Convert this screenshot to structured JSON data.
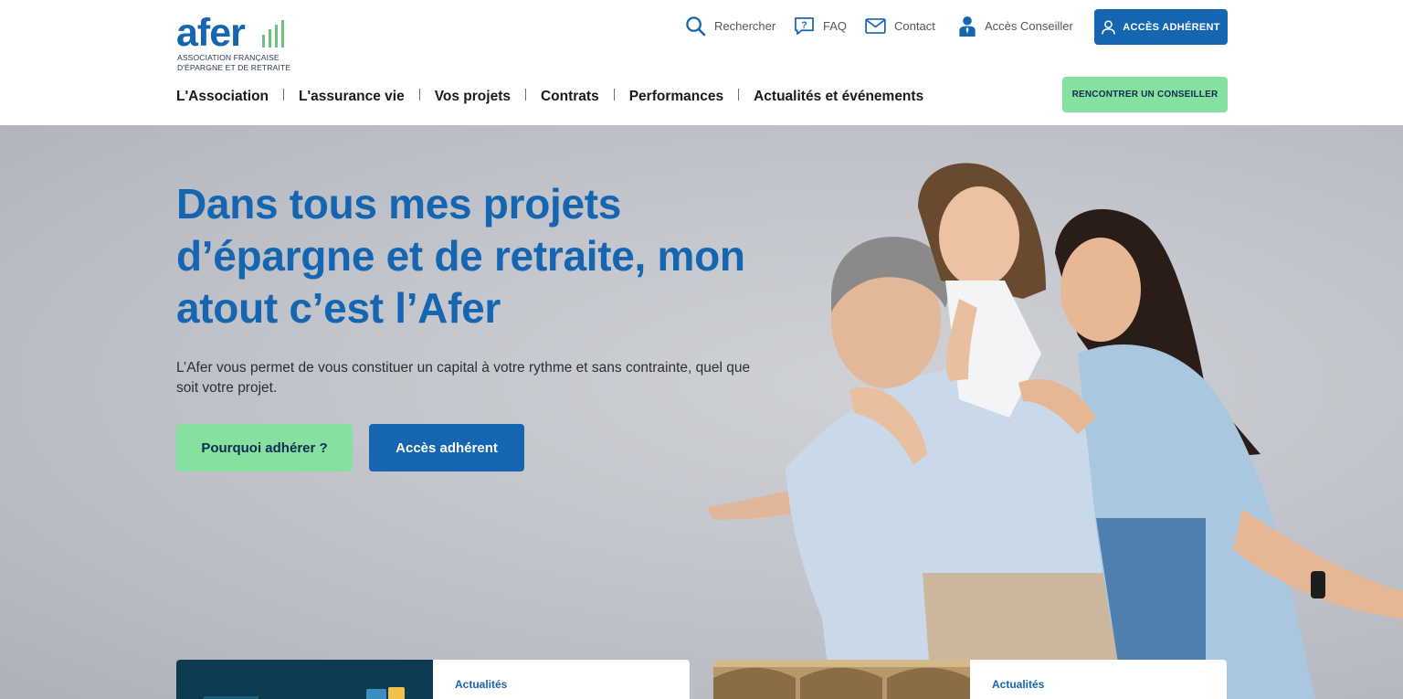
{
  "logo": {
    "word": "afer",
    "subtitle_line1": "ASSOCIATION FRANÇAISE",
    "subtitle_line2": "D'ÉPARGNE ET DE RETRAITE"
  },
  "utility_nav": {
    "search": {
      "label": "Rechercher",
      "icon": "search-icon"
    },
    "faq": {
      "label": "FAQ",
      "icon": "question-icon"
    },
    "contact": {
      "label": "Contact",
      "icon": "envelope-icon"
    },
    "conseiller": {
      "label": "Accès Conseiller",
      "icon": "advisor-icon"
    }
  },
  "header_buttons": {
    "acces_adherent": "ACCÈS ADHÉRENT",
    "rencontrer": "RENCONTRER UN CONSEILLER"
  },
  "main_nav": [
    {
      "label": "L'Association"
    },
    {
      "label": "L'assurance vie"
    },
    {
      "label": "Vos projets"
    },
    {
      "label": "Contrats"
    },
    {
      "label": "Performances"
    },
    {
      "label": "Actualités et événements"
    }
  ],
  "hero": {
    "title": "Dans tous mes projets d’épargne et de retraite, mon atout c’est l’Afer",
    "text": "L’Afer vous permet de vous constituer un capital à votre rythme et sans contrainte, quel que soit votre projet.",
    "btn_primary": "Pourquoi adhérer ?",
    "btn_secondary": "Accès adhérent"
  },
  "news": [
    {
      "tag": "Actualités"
    },
    {
      "tag": "Actualités"
    }
  ],
  "colors": {
    "brand_blue": "#1565b0",
    "brand_green": "#86e1a0",
    "dark_navy": "#0d2c52"
  }
}
